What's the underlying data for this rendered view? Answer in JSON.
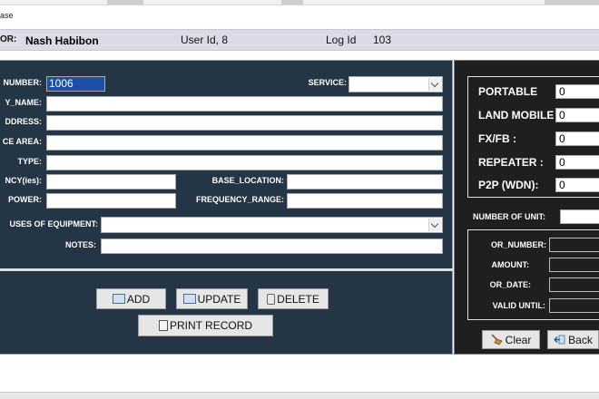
{
  "window": {
    "title": "ase"
  },
  "header": {
    "operator_label": "OR:",
    "operator_name": "Nash Habibon",
    "user_id_label": "User Id, 8",
    "log_id_label": "Log Id",
    "log_id_value": "103"
  },
  "form": {
    "or_number_label": "NUMBER:",
    "or_number_value": "1006",
    "service_label": "SERVICE:",
    "company_name_label": "Y_NAME:",
    "address_label": "DDRESS:",
    "service_area_label": "CE AREA:",
    "type_label": "TYPE:",
    "frequency_label": "NCY(ies):",
    "base_location_label": "BASE_LOCATION:",
    "power_label": "POWER:",
    "frequency_range_label": "FREQUENCY_RANGE:",
    "uses_of_equipment_label": "USES OF EQUIPMENT:",
    "notes_label": "NOTES:"
  },
  "buttons": {
    "add": "ADD",
    "update": "UPDATE",
    "delete": "DELETE",
    "print_record": "PRINT RECORD",
    "clear": "Clear",
    "back": "Back"
  },
  "units": {
    "portable_label": "PORTABLE",
    "portable_value": "0",
    "land_mobile_label": "LAND MOBILE",
    "land_mobile_value": "0",
    "fx_fb_label": "FX/FB  :",
    "fx_fb_value": "0",
    "repeater_label": "REPEATER :",
    "repeater_value": "0",
    "p2p_label": "P2P (WDN):",
    "p2p_value": "0",
    "number_of_unit_label": "NUMBER OF UNIT:"
  },
  "payment": {
    "or_number_label": "OR_NUMBER:",
    "amount_label": "AMOUNT:",
    "or_date_label": "OR_DATE:",
    "valid_until_label": "VALID UNTIL:"
  }
}
